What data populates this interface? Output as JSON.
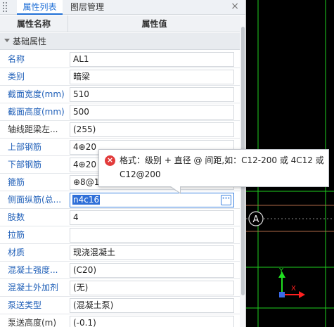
{
  "tabs": {
    "active": "属性列表",
    "inactive": "图层管理",
    "close_icon": "close-icon"
  },
  "columns": {
    "name": "属性名称",
    "value": "属性值"
  },
  "group": {
    "label": "基础属性"
  },
  "rows": [
    {
      "name": "名称",
      "value": "AL1",
      "color": "#1f5fb8"
    },
    {
      "name": "类别",
      "value": "暗梁",
      "color": "#1f5fb8"
    },
    {
      "name": "截面宽度(mm)",
      "value": "510",
      "color": "#1f5fb8"
    },
    {
      "name": "截面高度(mm)",
      "value": "500",
      "color": "#1f5fb8"
    },
    {
      "name": "轴线距梁左...",
      "value": "(255)",
      "color": "#333333"
    },
    {
      "name": "上部钢筋",
      "value": "4⊕20",
      "color": "#1f5fb8"
    },
    {
      "name": "下部钢筋",
      "value": "4⊕20",
      "color": "#1f5fb8"
    },
    {
      "name": "箍筋",
      "value": "⊕8@1",
      "color": "#1f5fb8"
    },
    {
      "name": "侧面纵筋(总...",
      "value": "n4c16",
      "color": "#1f5fb8"
    },
    {
      "name": "肢数",
      "value": "4",
      "color": "#1f5fb8"
    },
    {
      "name": "拉筋",
      "value": "",
      "color": "#1f5fb8"
    },
    {
      "name": "材质",
      "value": "现浇混凝土",
      "color": "#1f5fb8"
    },
    {
      "name": "混凝土强度...",
      "value": "(C20)",
      "color": "#1f5fb8"
    },
    {
      "name": "混凝土外加剂",
      "value": "(无)",
      "color": "#1f5fb8"
    },
    {
      "name": "泵送类型",
      "value": "(混凝土泵)",
      "color": "#1f5fb8"
    },
    {
      "name": "泵送高度(m)",
      "value": "(-0.1)",
      "color": "#333333"
    }
  ],
  "editing_row_index": 8,
  "ellipsis_label": "···",
  "tooltip": {
    "icon": "error-icon",
    "line1": "格式：级别 + 直径 @ 间距,如：C12-200 或 4C12 或",
    "line2": "C12@200"
  },
  "canvas": {
    "axis_label": "A",
    "x_label": "X",
    "y_label": "Y",
    "colors": {
      "background": "#000000",
      "line_green": "#1fd01f",
      "line_beam": "#b06a48",
      "axis_x": "#ff2020",
      "axis_y": "#20e020"
    }
  }
}
